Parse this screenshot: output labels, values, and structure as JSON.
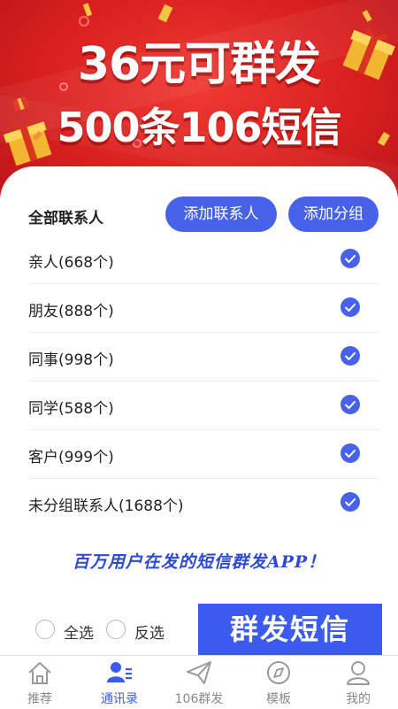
{
  "banner": {
    "line1": "36元可群发",
    "line2": "500条106短信"
  },
  "contacts": {
    "title": "全部联系人",
    "add_contact_label": "添加联系人",
    "add_group_label": "添加分组",
    "groups": [
      {
        "label": "亲人(668个)",
        "checked": true
      },
      {
        "label": "朋友(888个)",
        "checked": true
      },
      {
        "label": "同事(998个)",
        "checked": true
      },
      {
        "label": "同学(588个)",
        "checked": true
      },
      {
        "label": "客户(999个)",
        "checked": true
      },
      {
        "label": "未分组联系人(1688个)",
        "checked": true
      }
    ]
  },
  "slogan": "百万用户在发的短信群发APP！",
  "actions": {
    "select_all_label": "全选",
    "invert_label": "反选",
    "send_label": "群发短信"
  },
  "tabbar": {
    "tabs": [
      {
        "label": "推荐",
        "icon": "home-icon",
        "active": false
      },
      {
        "label": "通讯录",
        "icon": "contacts-icon",
        "active": true
      },
      {
        "label": "106群发",
        "icon": "paper-plane-icon",
        "active": false
      },
      {
        "label": "模板",
        "icon": "compass-icon",
        "active": false
      },
      {
        "label": "我的",
        "icon": "user-icon",
        "active": false
      }
    ]
  },
  "colors": {
    "banner_red": "#d9201f",
    "accent_blue": "#4762e8",
    "send_blue": "#3c5bee"
  }
}
